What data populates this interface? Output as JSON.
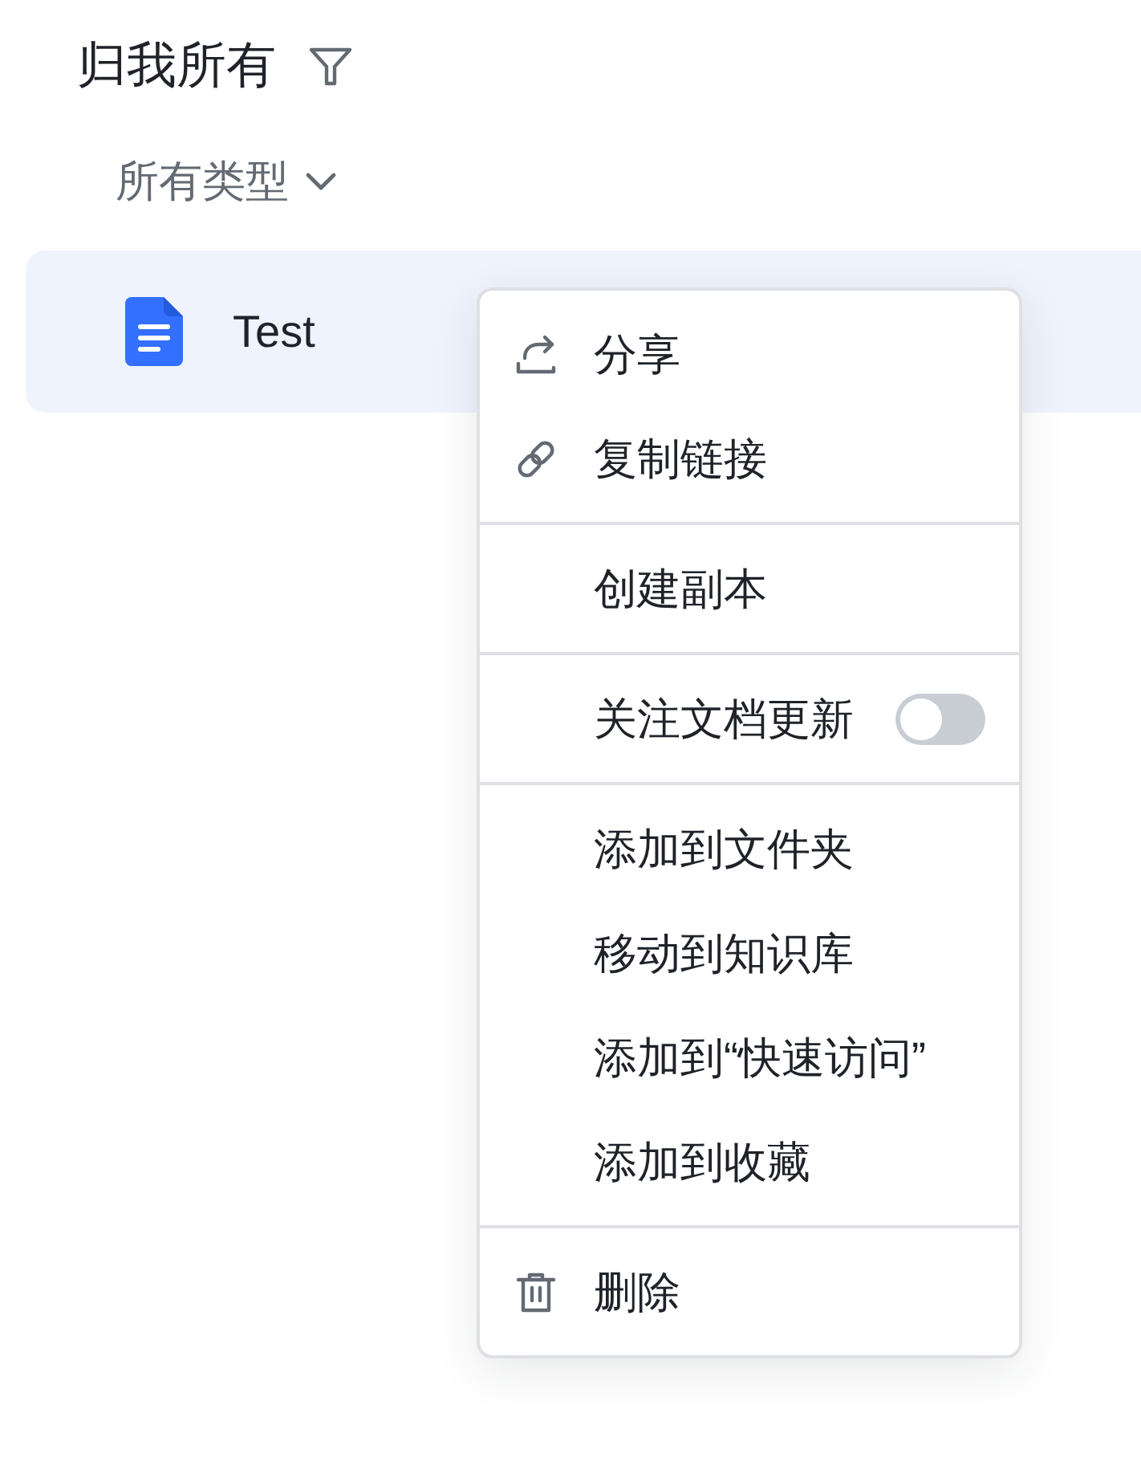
{
  "header": {
    "title": "归我所有"
  },
  "type_filter": {
    "label": "所有类型"
  },
  "files": [
    {
      "name": "Test",
      "selected": true
    }
  ],
  "context_menu": {
    "groups": [
      {
        "items": [
          {
            "label": "分享",
            "kind": "share"
          },
          {
            "label": "复制链接",
            "kind": "link"
          }
        ]
      },
      {
        "items": [
          {
            "label": "创建副本",
            "kind": "plain"
          }
        ]
      },
      {
        "items": [
          {
            "label": "关注文档更新",
            "kind": "toggle",
            "on": false
          }
        ]
      },
      {
        "items": [
          {
            "label": "添加到文件夹",
            "kind": "plain"
          },
          {
            "label": "移动到知识库",
            "kind": "plain"
          },
          {
            "label": "添加到“快速访问”",
            "kind": "plain"
          },
          {
            "label": "添加到收藏",
            "kind": "plain"
          }
        ]
      },
      {
        "items": [
          {
            "label": "删除",
            "kind": "delete"
          }
        ]
      }
    ]
  }
}
